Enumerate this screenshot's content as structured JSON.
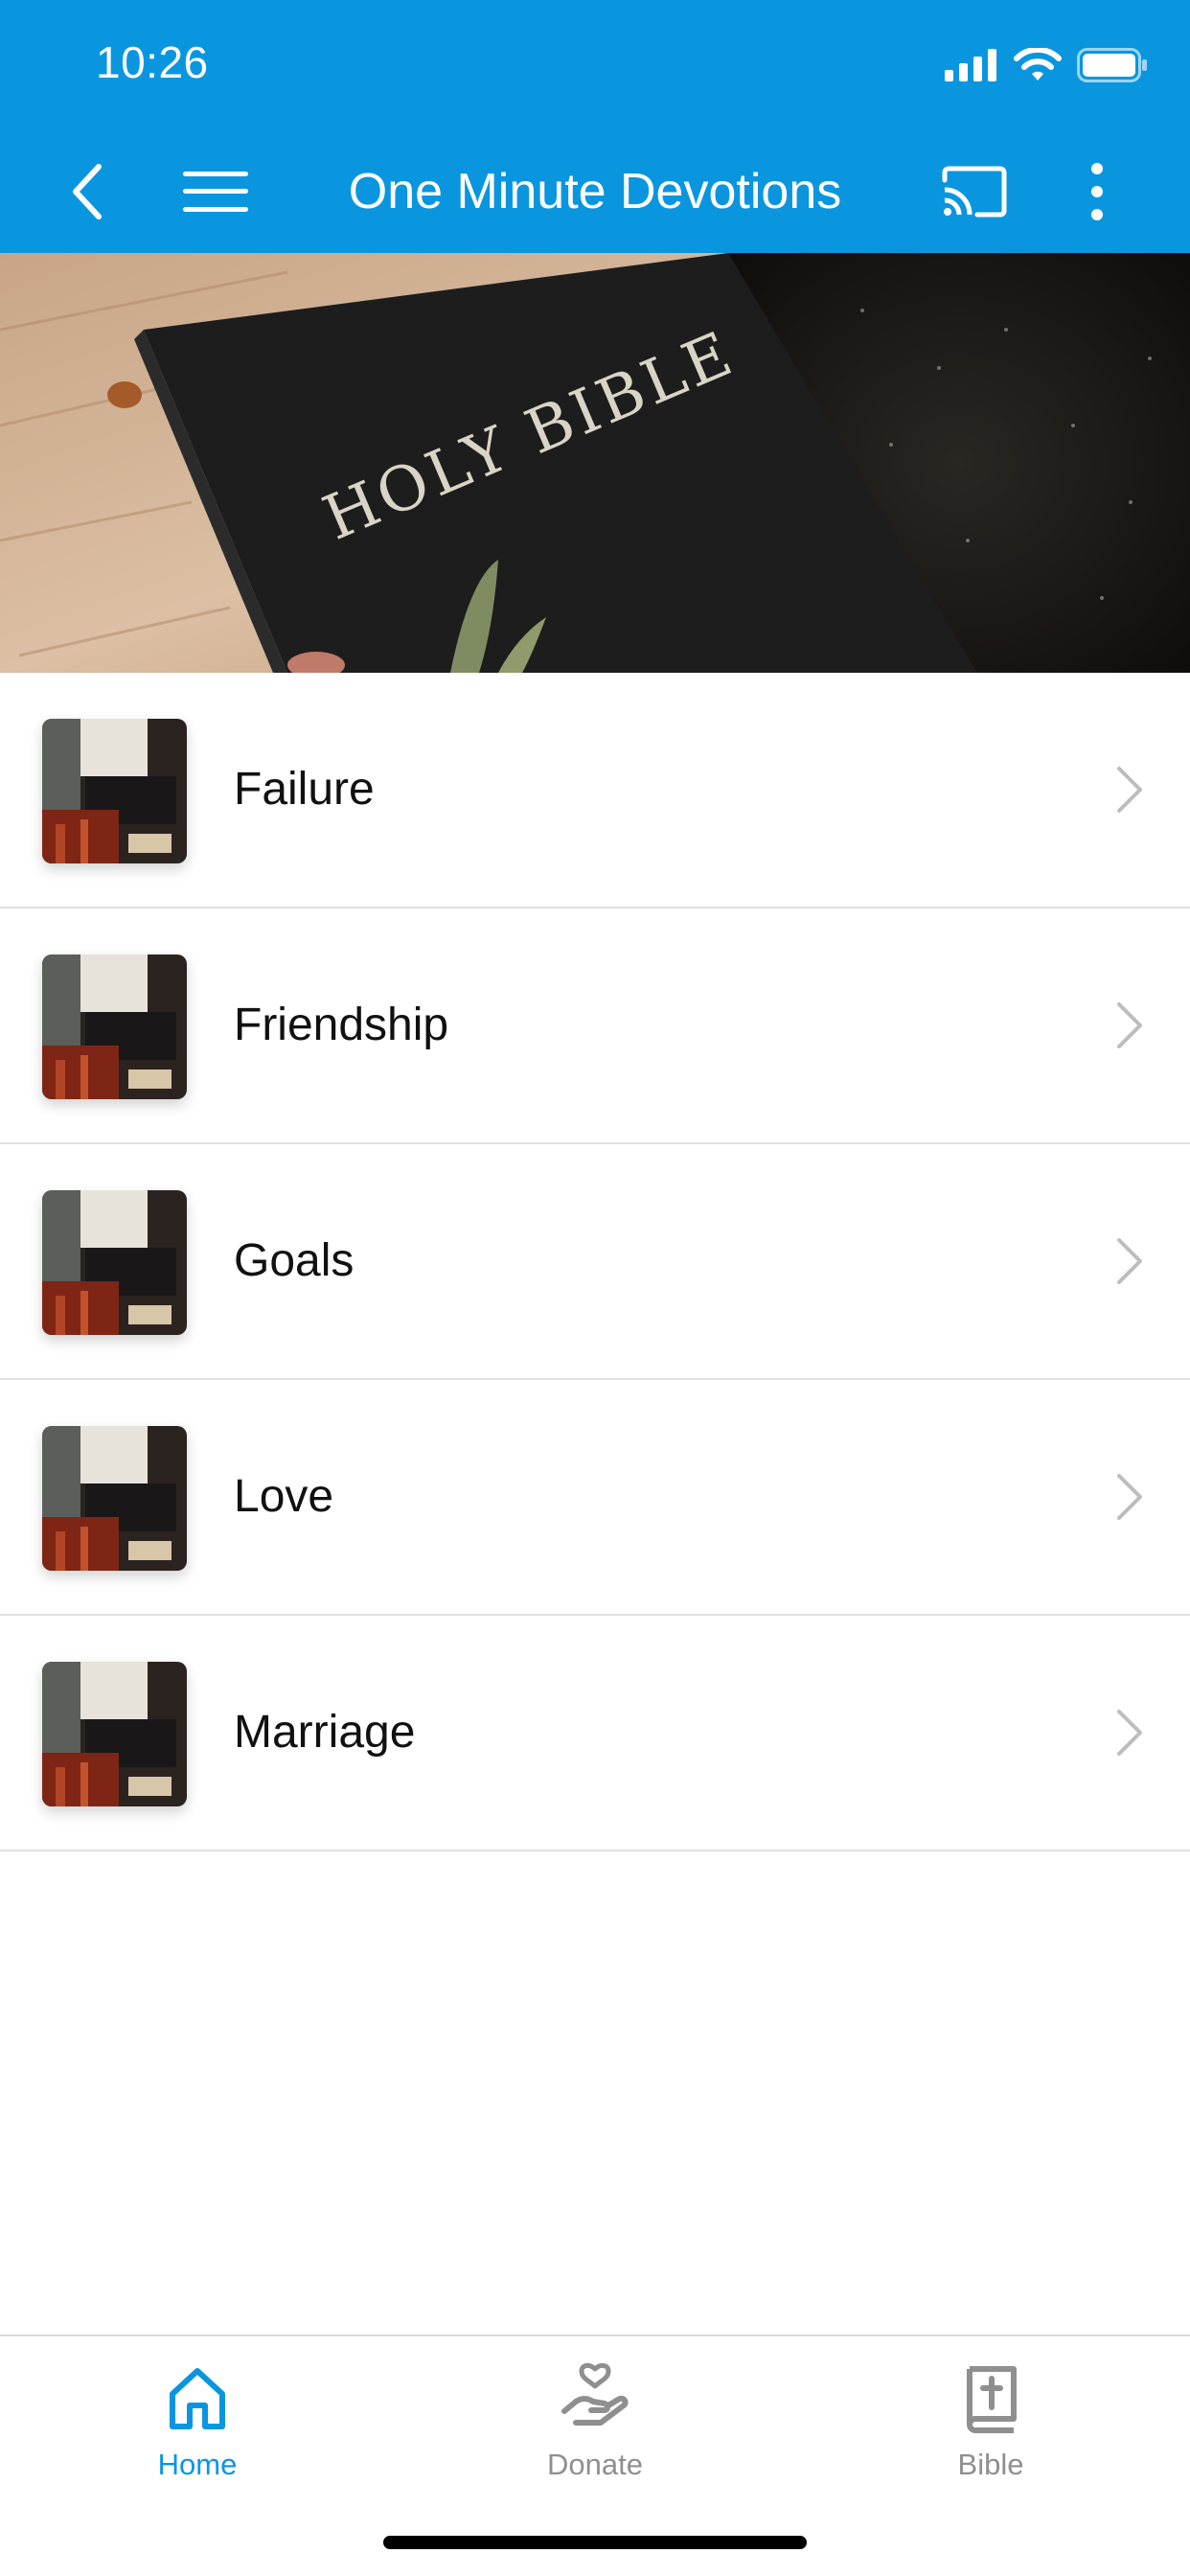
{
  "status_bar": {
    "time": "10:26"
  },
  "toolbar": {
    "title": "One Minute Devotions"
  },
  "hero": {
    "book_text": "HOLY BIBLE"
  },
  "list": {
    "items": [
      {
        "label": "Failure"
      },
      {
        "label": "Friendship"
      },
      {
        "label": "Goals"
      },
      {
        "label": "Love"
      },
      {
        "label": "Marriage"
      }
    ]
  },
  "bottom_nav": {
    "items": [
      {
        "label": "Home",
        "icon": "home-icon",
        "active": true
      },
      {
        "label": "Donate",
        "icon": "donate-icon",
        "active": false
      },
      {
        "label": "Bible",
        "icon": "bible-icon",
        "active": false
      }
    ]
  },
  "colors": {
    "accent": "#0a96df",
    "inactive": "#8f8f8f",
    "divider": "#e1e1e1"
  }
}
